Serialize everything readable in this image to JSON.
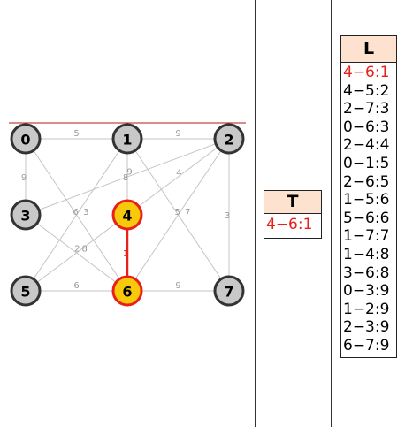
{
  "graph": {
    "nodes": [
      {
        "id": "0",
        "state": "normal"
      },
      {
        "id": "1",
        "state": "normal"
      },
      {
        "id": "2",
        "state": "normal"
      },
      {
        "id": "3",
        "state": "normal"
      },
      {
        "id": "4",
        "state": "selected"
      },
      {
        "id": "5",
        "state": "normal"
      },
      {
        "id": "6",
        "state": "selected"
      },
      {
        "id": "7",
        "state": "normal"
      }
    ],
    "edges": [
      {
        "u": "0",
        "v": "1",
        "w": "5",
        "state": "normal"
      },
      {
        "u": "1",
        "v": "2",
        "w": "9",
        "state": "normal"
      },
      {
        "u": "0",
        "v": "3",
        "w": "9",
        "state": "normal"
      },
      {
        "u": "0",
        "v": "6",
        "w": "3",
        "state": "normal"
      },
      {
        "u": "1",
        "v": "4",
        "w": "8",
        "state": "normal"
      },
      {
        "u": "1",
        "v": "5",
        "w": "6",
        "state": "normal"
      },
      {
        "u": "1",
        "v": "7",
        "w": "7",
        "state": "normal"
      },
      {
        "u": "2",
        "v": "3",
        "w": "9",
        "state": "normal"
      },
      {
        "u": "2",
        "v": "4",
        "w": "4",
        "state": "normal"
      },
      {
        "u": "2",
        "v": "6",
        "w": "5",
        "state": "normal"
      },
      {
        "u": "2",
        "v": "7",
        "w": "3",
        "state": "normal"
      },
      {
        "u": "3",
        "v": "6",
        "w": "8",
        "state": "normal"
      },
      {
        "u": "4",
        "v": "5",
        "w": "2",
        "state": "normal"
      },
      {
        "u": "4",
        "v": "6",
        "w": "1",
        "state": "highlight"
      },
      {
        "u": "5",
        "v": "6",
        "w": "6",
        "state": "normal"
      },
      {
        "u": "6",
        "v": "7",
        "w": "9",
        "state": "normal"
      }
    ]
  },
  "colors": {
    "node_fill": "#c8c8c8",
    "node_stroke": "#333333",
    "selected_fill": "#f7c90a",
    "selected_stroke": "#e8201a",
    "edge": "#c4c4c4",
    "highlight": "#e8201a",
    "table_header": "#fde2cf"
  },
  "table_T": {
    "title": "T",
    "rows": [
      {
        "text": "4−6:1",
        "highlight": true
      }
    ]
  },
  "table_L": {
    "title": "L",
    "rows": [
      {
        "text": "4−6:1",
        "highlight": true
      },
      {
        "text": "4−5:2",
        "highlight": false
      },
      {
        "text": "2−7:3",
        "highlight": false
      },
      {
        "text": "0−6:3",
        "highlight": false
      },
      {
        "text": "2−4:4",
        "highlight": false
      },
      {
        "text": "0−1:5",
        "highlight": false
      },
      {
        "text": "2−6:5",
        "highlight": false
      },
      {
        "text": "1−5:6",
        "highlight": false
      },
      {
        "text": "5−6:6",
        "highlight": false
      },
      {
        "text": "1−7:7",
        "highlight": false
      },
      {
        "text": "1−4:8",
        "highlight": false
      },
      {
        "text": "3−6:8",
        "highlight": false
      },
      {
        "text": "0−3:9",
        "highlight": false
      },
      {
        "text": "1−2:9",
        "highlight": false
      },
      {
        "text": "2−3:9",
        "highlight": false
      },
      {
        "text": "6−7:9",
        "highlight": false
      }
    ]
  }
}
